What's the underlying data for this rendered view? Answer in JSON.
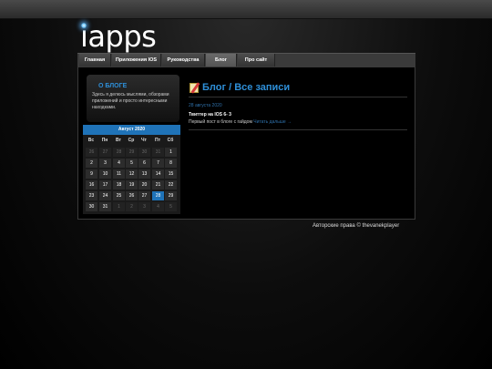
{
  "logo": "iapps",
  "nav": [
    {
      "label": "Главная",
      "active": false
    },
    {
      "label": "Приложения IOS",
      "active": false
    },
    {
      "label": "Руководства",
      "active": false
    },
    {
      "label": "Блог",
      "active": true
    },
    {
      "label": "Про сайт",
      "active": false
    }
  ],
  "sidebar": {
    "about_title": "О БЛОГЕ",
    "about_text": "Здесь я делюсь мыслями, обзорами приложений и просто интересными находками."
  },
  "calendar": {
    "title": "Август 2020",
    "weekdays": [
      "Вс",
      "Пн",
      "Вт",
      "Ср",
      "Чт",
      "Пт",
      "Сб"
    ],
    "weeks": [
      [
        {
          "d": "26",
          "dim": true
        },
        {
          "d": "27",
          "dim": true
        },
        {
          "d": "28",
          "dim": true
        },
        {
          "d": "29",
          "dim": true
        },
        {
          "d": "30",
          "dim": true
        },
        {
          "d": "31",
          "dim": true
        },
        {
          "d": "1"
        }
      ],
      [
        {
          "d": "2"
        },
        {
          "d": "3"
        },
        {
          "d": "4"
        },
        {
          "d": "5"
        },
        {
          "d": "6"
        },
        {
          "d": "7"
        },
        {
          "d": "8"
        }
      ],
      [
        {
          "d": "9"
        },
        {
          "d": "10"
        },
        {
          "d": "11"
        },
        {
          "d": "12"
        },
        {
          "d": "13"
        },
        {
          "d": "14"
        },
        {
          "d": "15"
        }
      ],
      [
        {
          "d": "16"
        },
        {
          "d": "17"
        },
        {
          "d": "18"
        },
        {
          "d": "19"
        },
        {
          "d": "20"
        },
        {
          "d": "21"
        },
        {
          "d": "22"
        }
      ],
      [
        {
          "d": "23"
        },
        {
          "d": "24"
        },
        {
          "d": "25"
        },
        {
          "d": "26"
        },
        {
          "d": "27"
        },
        {
          "d": "28",
          "today": true
        },
        {
          "d": "29"
        }
      ],
      [
        {
          "d": "30"
        },
        {
          "d": "31"
        },
        {
          "d": "1",
          "dim": true
        },
        {
          "d": "2",
          "dim": true
        },
        {
          "d": "3",
          "dim": true
        },
        {
          "d": "4",
          "dim": true
        },
        {
          "d": "5",
          "dim": true
        }
      ]
    ]
  },
  "main": {
    "title": "Блог / Все записи",
    "post": {
      "date": "28 августа 2020",
      "title": "Твиттер на IOS 6- 3",
      "excerpt": "Первый пост в блоге с гайдом",
      "more": "Читать дальше →"
    }
  },
  "footer": "Авторские права © thevanekplayer",
  "colors": {
    "accent": "#2e8fd8",
    "nav_bg": "#3a3a3a",
    "calendar_today": "#1f73b8"
  }
}
